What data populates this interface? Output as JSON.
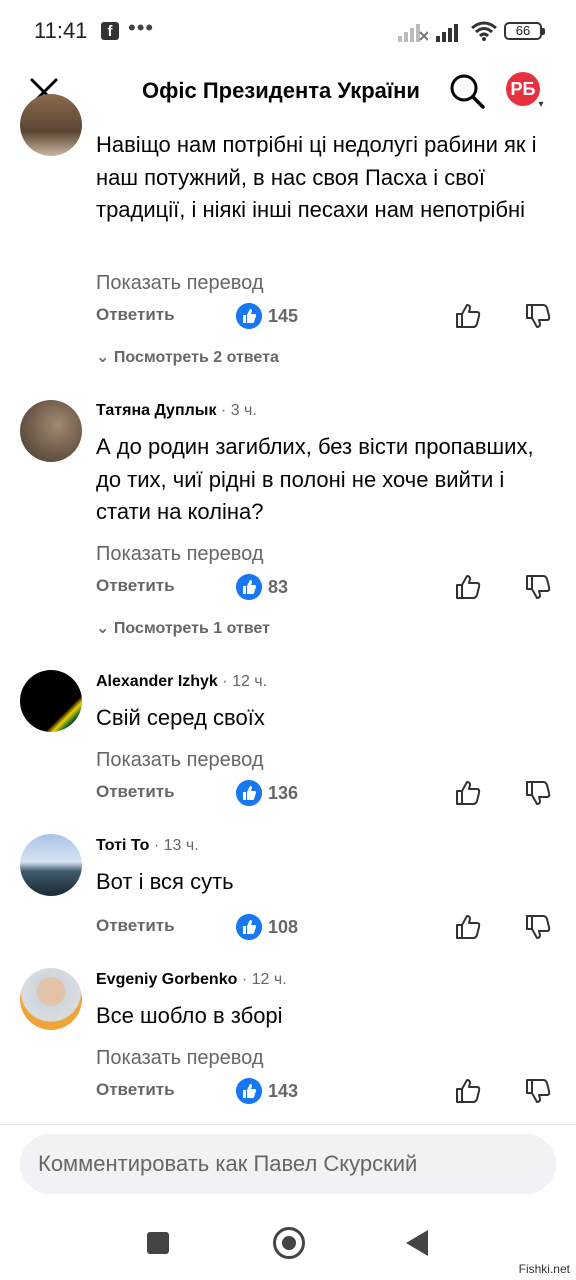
{
  "status_bar": {
    "time": "11:41",
    "fb_glyph": "f",
    "dots": "•••",
    "battery": "66"
  },
  "header": {
    "title": "Офіс Президента України",
    "close_icon": "close-icon",
    "search_icon": "search-icon",
    "profile_initials": "РБ"
  },
  "comments": [
    {
      "author": "",
      "time": "",
      "text": "Навіщо  нам потрібні ці недолугі рабини як і наш потужний, в нас своя Пасха і свої традиції, і ніякі інші песахи нам непотрібні",
      "translate": "Показать перевод",
      "reply": "Ответить",
      "likes": "145",
      "view_replies": "Посмотреть 2 ответа"
    },
    {
      "author": "Татяна Дуплык",
      "time": "3 ч.",
      "text": "А до родин загиблих, без вісти пропавших, до тих, чиї рідні в полоні не хоче вийти і стати на коліна?",
      "translate": "Показать перевод",
      "reply": "Ответить",
      "likes": "83",
      "view_replies": "Посмотреть 1 ответ"
    },
    {
      "author": "Alexander Izhyk",
      "time": "12 ч.",
      "text": "Свій серед своїх",
      "translate": "Показать перевод",
      "reply": "Ответить",
      "likes": "136"
    },
    {
      "author": "Тоті То",
      "time": "13 ч.",
      "text": "Вот і вся суть",
      "reply": "Ответить",
      "likes": "108"
    },
    {
      "author": "Evgeniy Gorbenko",
      "time": "12 ч.",
      "text": "Все шобло в зборі",
      "translate": "Показать перевод",
      "reply": "Ответить",
      "likes": "143"
    }
  ],
  "composer": {
    "placeholder": "Комментировать как Павел Скурский"
  },
  "watermark": "Fishki.net",
  "colors": {
    "like_blue": "#1877f2",
    "meta_gray": "#65676b",
    "brand_red": "#e8313f"
  }
}
